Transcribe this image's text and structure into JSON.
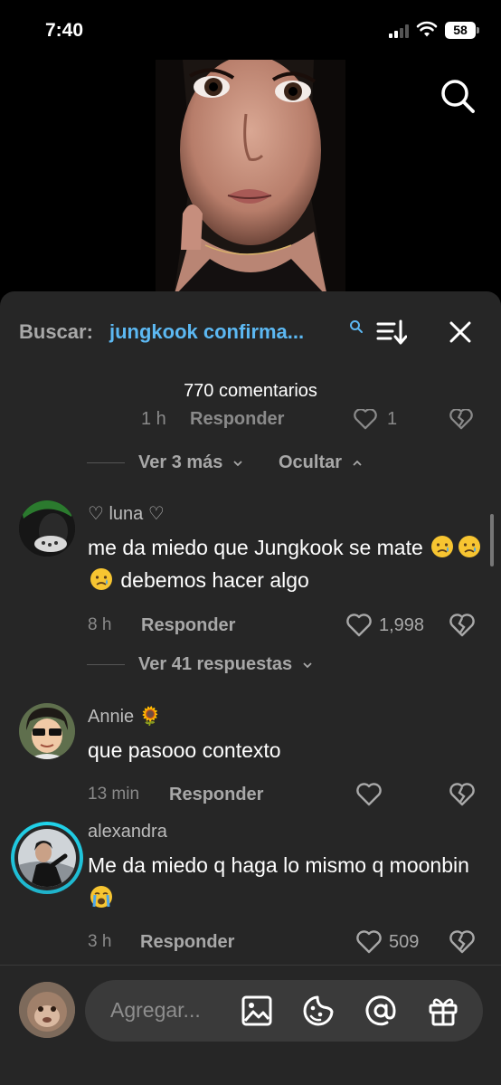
{
  "status_bar": {
    "time": "7:40",
    "battery": "58"
  },
  "sheet": {
    "search_label": "Buscar:",
    "search_query": "jungkook confirma...",
    "comment_count": "770 comentarios"
  },
  "partial_row": {
    "time": "1 h",
    "reply": "Responder",
    "likes": "1"
  },
  "thread_toggle": {
    "more": "Ver 3 más",
    "hide": "Ocultar"
  },
  "comments": [
    {
      "username": "♡ luna ♡",
      "text_before": "me da miedo que Jungkook se mate",
      "emoji": "😢😢😢",
      "text_after": "debemos hacer algo",
      "time": "8 h",
      "reply": "Responder",
      "likes": "1,998"
    },
    {
      "username": "Annie",
      "username_emoji": "🌻",
      "text": "que pasooo contexto",
      "time": "13 min",
      "reply": "Responder",
      "likes": ""
    },
    {
      "username": "alexandra",
      "text": "Me da miedo q haga lo mismo q moonbin",
      "text_emoji": "😭",
      "time": "3 h",
      "reply": "Responder",
      "likes": "509"
    }
  ],
  "view_replies": "Ver 41 respuestas",
  "composer": {
    "placeholder": "Agregar..."
  },
  "icons": {
    "search": "search-icon",
    "sort": "sort-icon",
    "close": "close-icon",
    "heart": "heart-icon",
    "dislike": "broken-heart-icon",
    "image": "image-icon",
    "sticker": "sticker-icon",
    "mention": "at-icon",
    "gift": "gift-icon"
  },
  "colors": {
    "accent": "#5cb8f2",
    "sheet_bg": "#262626",
    "story_ring": "#20d5ec"
  }
}
